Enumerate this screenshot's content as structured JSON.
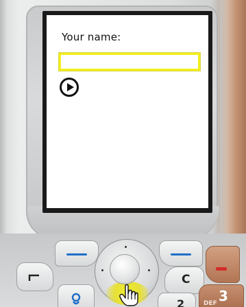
{
  "screen": {
    "label": "Your name:",
    "name_input_value": ""
  },
  "keys": {
    "c": "C",
    "two": "2",
    "three": "3",
    "three_letters": "DEF"
  },
  "colors": {
    "input_border": "#f2ef1b",
    "softkey_line": "#1f6fc8",
    "nav_highlight": "#e6e03a",
    "end_key": "#b27553"
  },
  "icons": {
    "go": "play-circle-icon",
    "call": "call-icon",
    "end": "end-call-icon",
    "menu": "menu-icon",
    "cursor": "hand-pointer-icon"
  }
}
